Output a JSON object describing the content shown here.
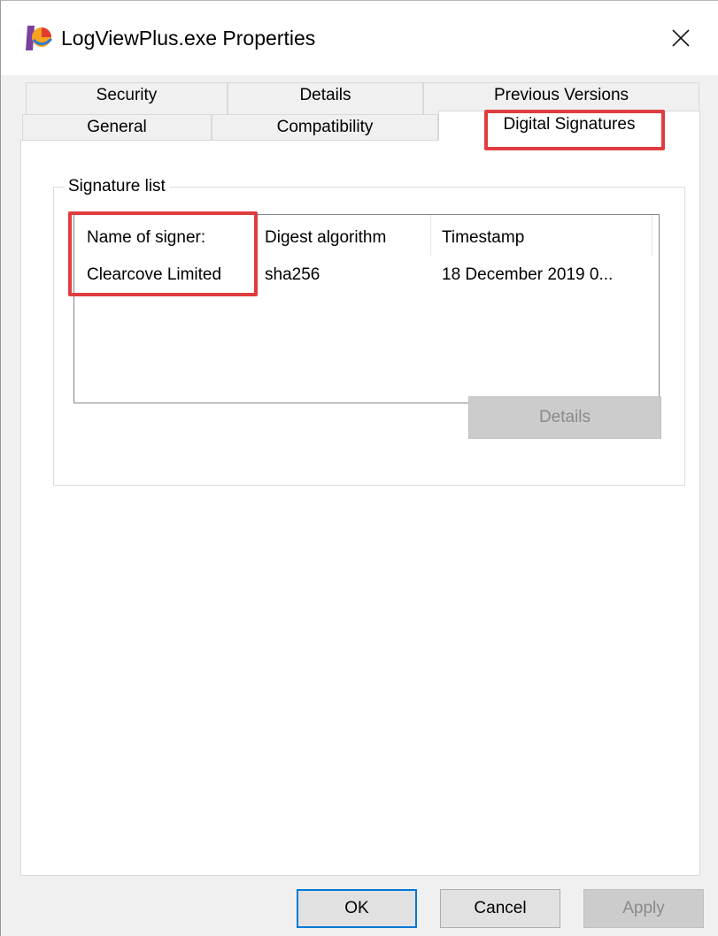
{
  "window": {
    "title": "LogViewPlus.exe Properties",
    "close_glyph": "✕"
  },
  "tabs": {
    "row1": [
      {
        "label": "Security",
        "icon": null
      },
      {
        "label": "Details",
        "icon": null
      },
      {
        "label": "Previous Versions",
        "icon": null
      }
    ],
    "row2": [
      {
        "label": "General",
        "icon": null
      },
      {
        "label": "Compatibility",
        "icon": null
      },
      {
        "label": "Digital Signatures",
        "icon": null,
        "active": true
      }
    ]
  },
  "signature_group": {
    "label": "Signature list",
    "columns": [
      "Name of signer:",
      "Digest algorithm",
      "Timestamp"
    ],
    "rows": [
      [
        "Clearcove Limited",
        "sha256",
        "18 December 2019 0..."
      ]
    ],
    "details_button": "Details",
    "details_disabled": true
  },
  "footer": {
    "ok": "OK",
    "cancel": "Cancel",
    "apply": "Apply",
    "apply_disabled": true
  },
  "colors": {
    "highlight": "#e03c40",
    "accent": "#0078d7"
  }
}
